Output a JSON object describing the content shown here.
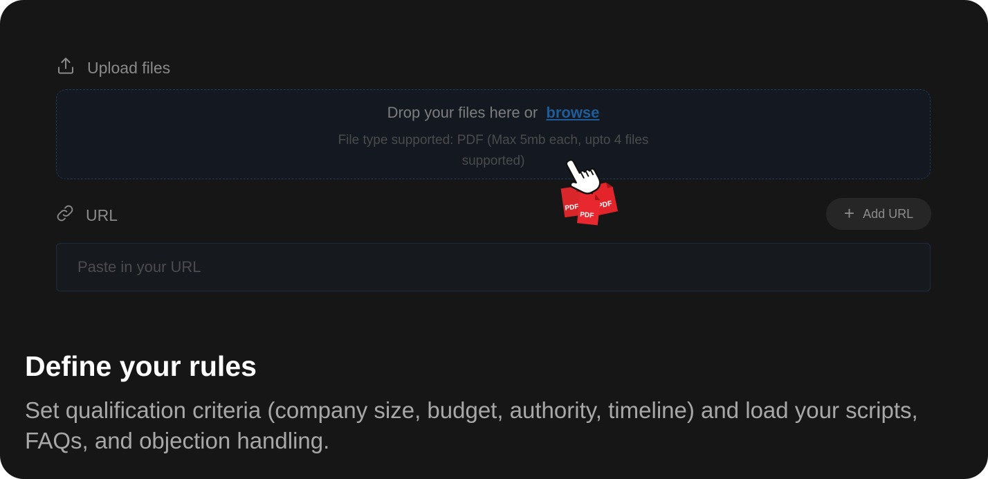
{
  "upload": {
    "label": "Upload files",
    "icon": "upload-icon",
    "drop_text": "Drop your files here or",
    "browse_label": "browse",
    "hint": "File type supported: PDF (Max 5mb each, upto 4 files supported)"
  },
  "url": {
    "label": "URL",
    "icon": "link-icon",
    "add_button_label": "Add URL",
    "add_button_icon": "plus-icon",
    "input_placeholder": "Paste in your URL"
  },
  "cursor_art": {
    "icon": "hand-pointer-icon",
    "badge_labels": [
      "PDF",
      "PDF",
      "PDF"
    ]
  },
  "feature": {
    "title": "Define your rules",
    "description": "Set qualification criteria (company size, budget, authority, timeline) and load your scripts, FAQs, and objection handling."
  },
  "colors": {
    "background": "#161616",
    "accent": "#1e5d99",
    "pdf_red": "#e3242b"
  }
}
